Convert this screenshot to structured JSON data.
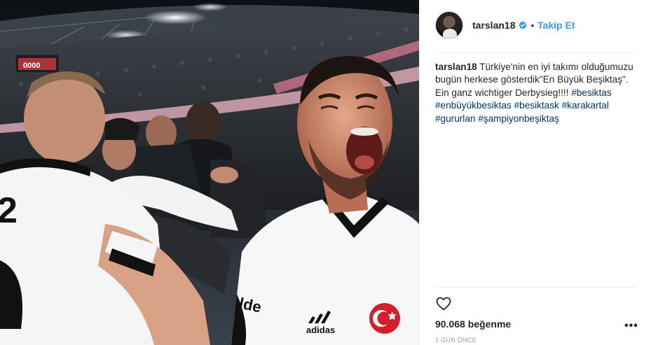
{
  "post": {
    "image_alt": "",
    "author": {
      "username": "tarslan18",
      "verified": true
    },
    "follow_label": "Takip Et",
    "separator": "•",
    "caption": {
      "username": "tarslan18",
      "text_parts": [
        {
          "type": "text",
          "value": " Türkiye'nin en iyi takımı olduğumuzu bugün herkese gösterdik\"En Büyük Beşiktaş\". Ein ganz wichtiger Derbysieg!!!! "
        },
        {
          "type": "tag",
          "value": "#besiktas"
        },
        {
          "type": "text",
          "value": " "
        },
        {
          "type": "tag",
          "value": "#enbüyükbesiktas"
        },
        {
          "type": "text",
          "value": " "
        },
        {
          "type": "tag",
          "value": "#besiktask"
        },
        {
          "type": "text",
          "value": " "
        },
        {
          "type": "tag",
          "value": "#karakartal"
        },
        {
          "type": "text",
          "value": " "
        },
        {
          "type": "tag",
          "value": "#gururlan"
        },
        {
          "type": "text",
          "value": " "
        },
        {
          "type": "tag",
          "value": "#şampiyonbeşiktaş"
        }
      ]
    },
    "likes_label": "90.068 beğenme",
    "time_ago": "1 GÜN ÖNCE",
    "more_label": "•••"
  },
  "photo": {
    "jersey_brand": "adidas",
    "jersey_print": "lde",
    "scoreboard": "0000",
    "back_number": "2"
  },
  "colors": {
    "link": "#003569",
    "follow": "#3897f0",
    "verified": "#3897f0",
    "text": "#262626",
    "muted": "#999999",
    "divider": "#efefef"
  },
  "icons": {
    "verified": "verified-badge-icon",
    "like": "heart-outline-icon",
    "more": "more-options-icon",
    "flag": "turkish-flag-icon"
  }
}
